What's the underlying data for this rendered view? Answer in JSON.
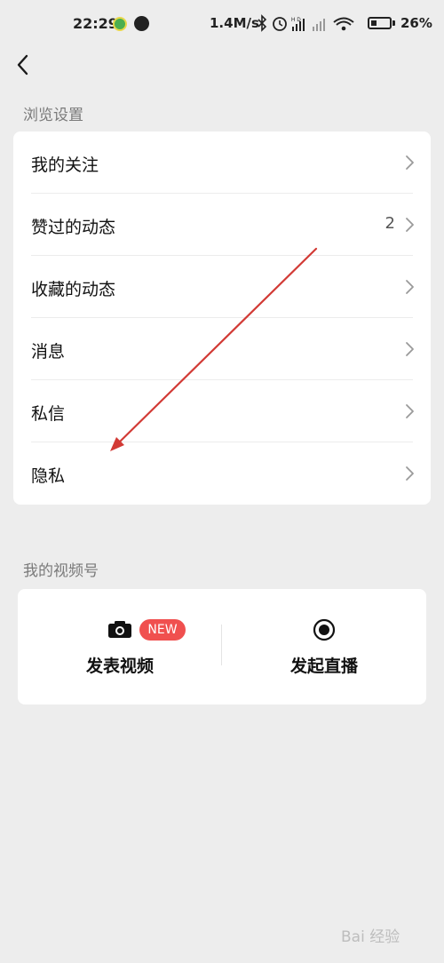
{
  "status_bar": {
    "time": "22:29",
    "network_speed": "1.4M/s",
    "battery_percent": "26%",
    "icons": [
      "bluetooth-icon",
      "alarm-icon",
      "hd-signal-icon",
      "signal-icon",
      "wifi-icon",
      "battery-icon"
    ]
  },
  "browse_settings": {
    "title": "浏览设置",
    "items": [
      {
        "label": "我的关注",
        "count": ""
      },
      {
        "label": "赞过的动态",
        "count": "2"
      },
      {
        "label": "收藏的动态",
        "count": ""
      },
      {
        "label": "消息",
        "count": ""
      },
      {
        "label": "私信",
        "count": ""
      },
      {
        "label": "隐私",
        "count": ""
      }
    ]
  },
  "channels": {
    "title": "我的视频号",
    "post_video_label": "发表视频",
    "new_badge": "NEW",
    "live_label": "发起直播"
  },
  "annotation_arrow_color": "#d23a35",
  "watermark": "Bai 经验"
}
